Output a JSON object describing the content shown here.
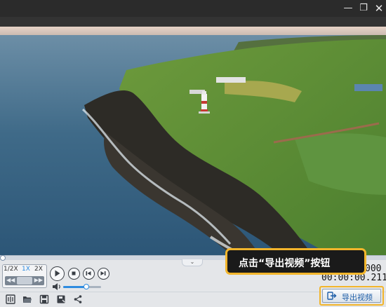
{
  "window": {
    "minimize_glyph": "—",
    "maximize_glyph": "❐",
    "close_glyph": "✕"
  },
  "video": {
    "description_icon": "video-frame"
  },
  "speed": {
    "options": [
      "1/2X",
      "1X",
      "2X"
    ],
    "selected": "1X",
    "step_back_glyph": "◀◀",
    "step_fwd_glyph": "▶▶"
  },
  "playback": {
    "progress_fraction": 0.0,
    "volume_fraction": 0.62
  },
  "time": {
    "total": "000",
    "current": "00:00:00.211"
  },
  "toolbar": {
    "icons": [
      "split-icon",
      "folder-open-icon",
      "save-icon",
      "save-as-icon",
      "share-icon"
    ]
  },
  "export": {
    "label": "导出视频"
  },
  "callout": {
    "text": "点击“导出视频”按钮"
  },
  "colors": {
    "accent": "#2e8be0",
    "highlight": "#f2b52b"
  }
}
